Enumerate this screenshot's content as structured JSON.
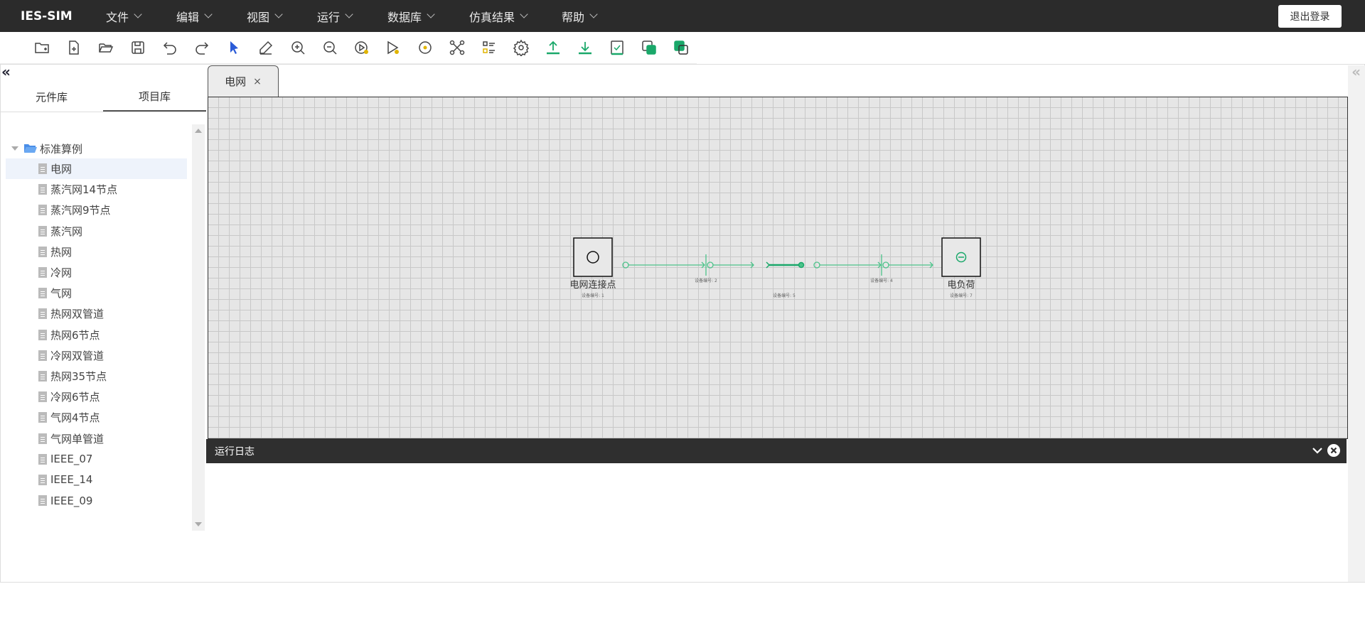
{
  "app": {
    "brand": "IES-SIM",
    "logout_label": "退出登录"
  },
  "menu": [
    {
      "label": "文件"
    },
    {
      "label": "编辑"
    },
    {
      "label": "视图"
    },
    {
      "label": "运行"
    },
    {
      "label": "数据库"
    },
    {
      "label": "仿真结果"
    },
    {
      "label": "帮助"
    }
  ],
  "toolbar": [
    "new-folder-icon",
    "new-file-icon",
    "open-folder-icon",
    "save-icon",
    "undo-icon",
    "redo-icon",
    "pointer-icon",
    "pencil-icon",
    "zoom-in-icon",
    "zoom-out-icon",
    "play-icon",
    "run-step-icon",
    "record-icon",
    "connect-nodes-icon",
    "list-settings-icon",
    "gear-icon",
    "upload-icon",
    "download-icon",
    "checklist-icon",
    "copy-icon",
    "layers-icon"
  ],
  "sidebar": {
    "tabs": [
      {
        "label": "元件库"
      },
      {
        "label": "项目库"
      }
    ],
    "root_label": "标准算例",
    "items": [
      {
        "label": "电网"
      },
      {
        "label": "蒸汽网14节点"
      },
      {
        "label": "蒸汽网9节点"
      },
      {
        "label": "蒸汽网"
      },
      {
        "label": "热网"
      },
      {
        "label": "冷网"
      },
      {
        "label": "气网"
      },
      {
        "label": "热网双管道"
      },
      {
        "label": "热网6节点"
      },
      {
        "label": "冷网双管道"
      },
      {
        "label": "热网35节点"
      },
      {
        "label": "冷网6节点"
      },
      {
        "label": "气网4节点"
      },
      {
        "label": "气网单管道"
      },
      {
        "label": "IEEE_07"
      },
      {
        "label": "IEEE_14"
      },
      {
        "label": "IEEE_09"
      }
    ]
  },
  "editor": {
    "tab_label": "电网",
    "close_symbol": "×"
  },
  "diagram": {
    "source_label": "电网连接点",
    "source_tag": "设备编号: 1",
    "load_label": "电负荷",
    "load_tag": "设备编号: 7",
    "tag_2": "设备编号: 2",
    "tag_5": "设备编号: 5",
    "tag_4": "设备编号: 4",
    "line_color": "#4cc38a"
  },
  "log": {
    "title": "运行日志"
  }
}
